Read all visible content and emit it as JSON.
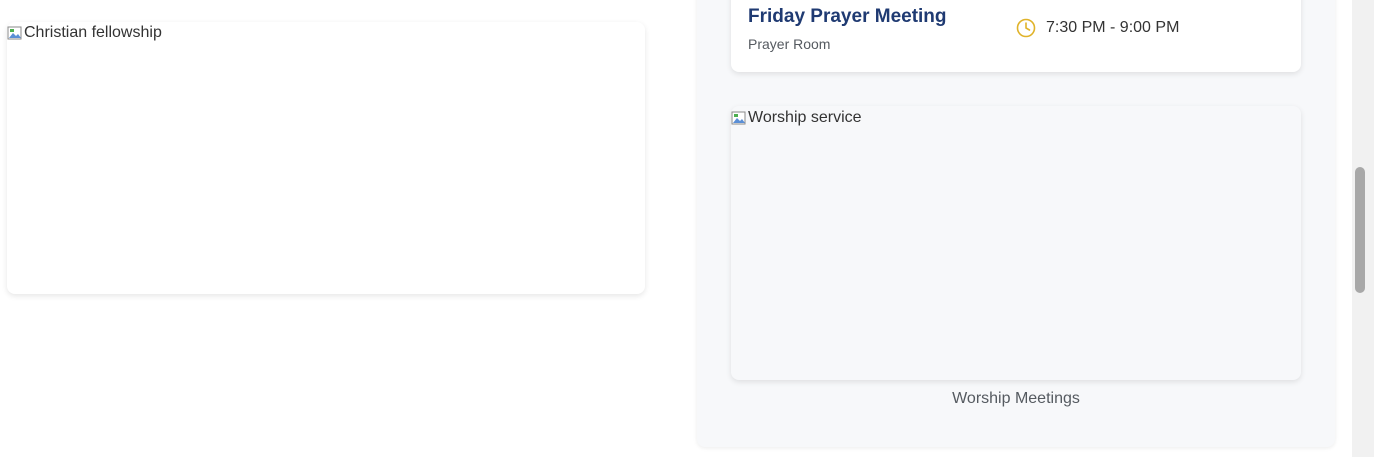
{
  "left_image": {
    "alt": "Christian fellowship"
  },
  "event": {
    "title": "Friday Prayer Meeting",
    "location": "Prayer Room",
    "time": "7:30 PM - 9:00 PM",
    "icon": "clock-icon",
    "title_color": "#1f3a72",
    "icon_color": "#e0b32a"
  },
  "worship": {
    "image_alt": "Worship service",
    "caption": "Worship Meetings"
  }
}
